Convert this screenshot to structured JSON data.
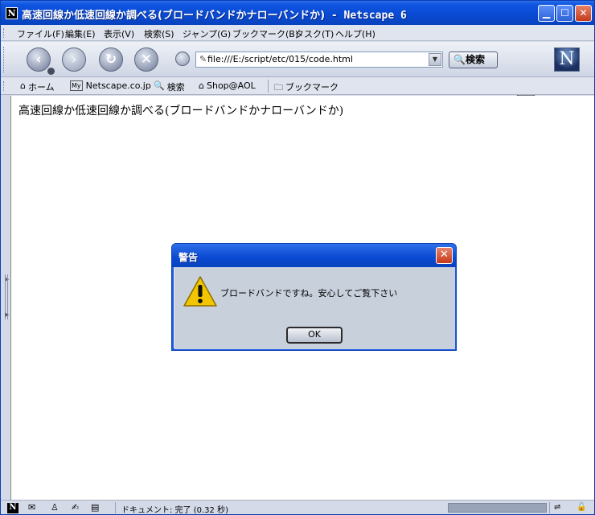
{
  "window": {
    "title": "高速回線か低速回線か調べる(ブロードバンドかナローバンドか)",
    "title_suffix": " - Netscape 6",
    "app_icon": "N"
  },
  "menu": [
    "ファイル(F)",
    "編集(E)",
    "表示(V)",
    "検索(S)",
    "ジャンプ(G)",
    "ブックマーク(B)",
    "タスク(T)",
    "ヘルプ(H)"
  ],
  "navigation": {
    "url": "file:///E:/script/etc/015/code.html",
    "search_label": "検索"
  },
  "personal_toolbar": {
    "home": "ホーム",
    "my_icon": "My",
    "netscape": "Netscape.co.jp",
    "search": "検索",
    "shop": "Shop@AOL",
    "bookmarks": "ブックマーク"
  },
  "page": {
    "heading": "高速回線か低速回線か調べる(ブロードバンドかナローバンドか)"
  },
  "dialog": {
    "title": "警告",
    "message": "ブロードバンドですね。安心してご覧下さい",
    "ok_label": "OK"
  },
  "statusbar": {
    "text": "ドキュメント: 完了 (0.32 秒)"
  }
}
